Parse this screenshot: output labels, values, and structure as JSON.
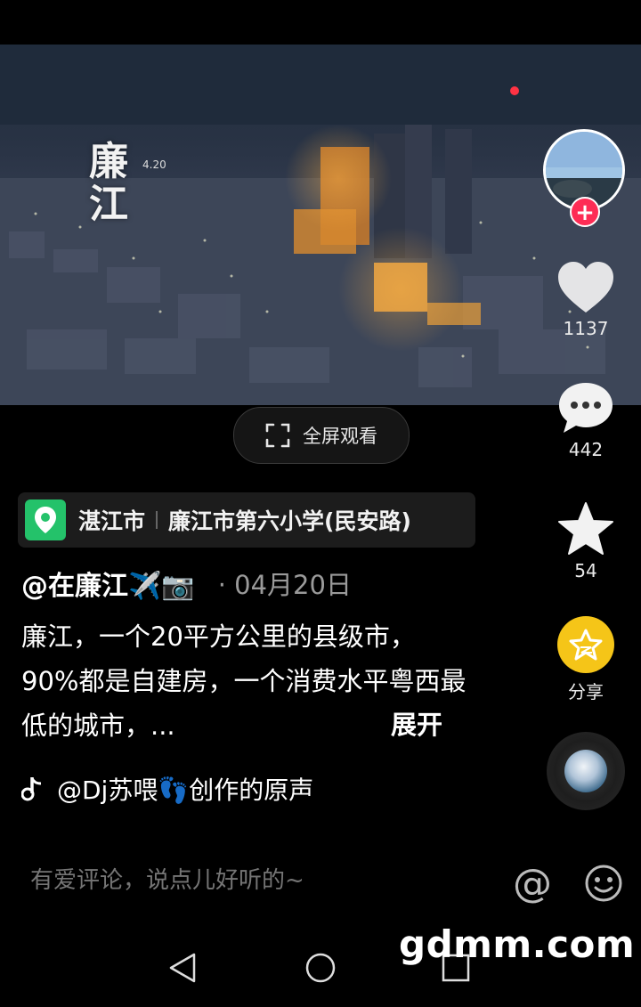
{
  "video": {
    "overlay_title": "廉江",
    "overlay_date": "4.20"
  },
  "fullscreen": {
    "label": "全屏观看"
  },
  "side_actions": {
    "like_count": "1137",
    "comment_count": "442",
    "favorite_count": "54",
    "share_label": "分享"
  },
  "location": {
    "city": "湛江市",
    "place": "廉江市第六小学(民安路)"
  },
  "post": {
    "author": "@在廉江✈️📷",
    "date": "· 04月20日",
    "caption": "廉江，一个20平方公里的县级市，90%都是自建房，一个消费水平粤西最低的城市，...",
    "expand_label": "展开"
  },
  "music": {
    "label": "@Dj苏喂👣创作的原声"
  },
  "comment": {
    "placeholder": "有爱评论，说点儿好听的~"
  },
  "watermark": "gdmm.com",
  "icons": {
    "location": "location-pin-icon",
    "like": "heart-icon",
    "comment": "comment-bubble-icon",
    "favorite": "star-icon",
    "share": "share-star-icon",
    "music": "music-note-icon",
    "mention": "at-icon",
    "emoji": "emoji-icon",
    "nav_back": "back-triangle-icon",
    "nav_home": "home-circle-icon",
    "nav_recent": "recent-square-icon"
  },
  "colors": {
    "accent_red": "#fe2c55",
    "location_green": "#24c26a",
    "share_yellow": "#f5c518"
  }
}
